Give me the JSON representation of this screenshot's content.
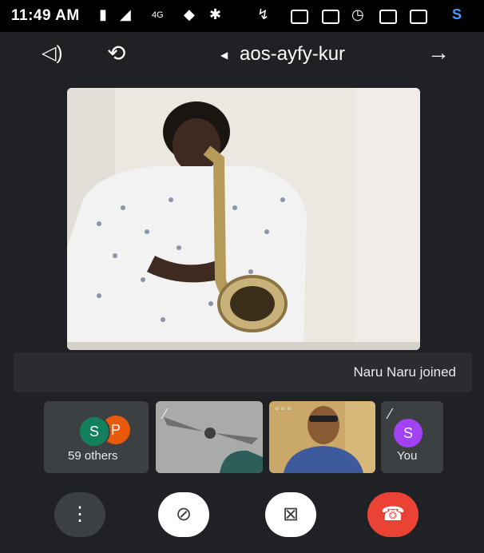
{
  "status_bar": {
    "time": "11:49 AM",
    "network": "4G"
  },
  "top_bar": {
    "meeting_code": "aos-ayfy-kur"
  },
  "toast": {
    "message": "Naru Naru joined"
  },
  "tiles": {
    "others": {
      "avatar_p": "P",
      "avatar_s": "S",
      "label": "59 others"
    },
    "self": {
      "avatar": "S",
      "label": "You"
    }
  },
  "colors": {
    "end_call": "#ea4335",
    "avatar_purple": "#a142f4",
    "avatar_orange": "#e8590c",
    "avatar_teal": "#12805c"
  },
  "icons": [
    "back-arrow-icon",
    "switch-camera-icon",
    "speaker-icon",
    "mic-off-icon",
    "camera-off-icon",
    "end-call-icon",
    "more-options-icon"
  ]
}
